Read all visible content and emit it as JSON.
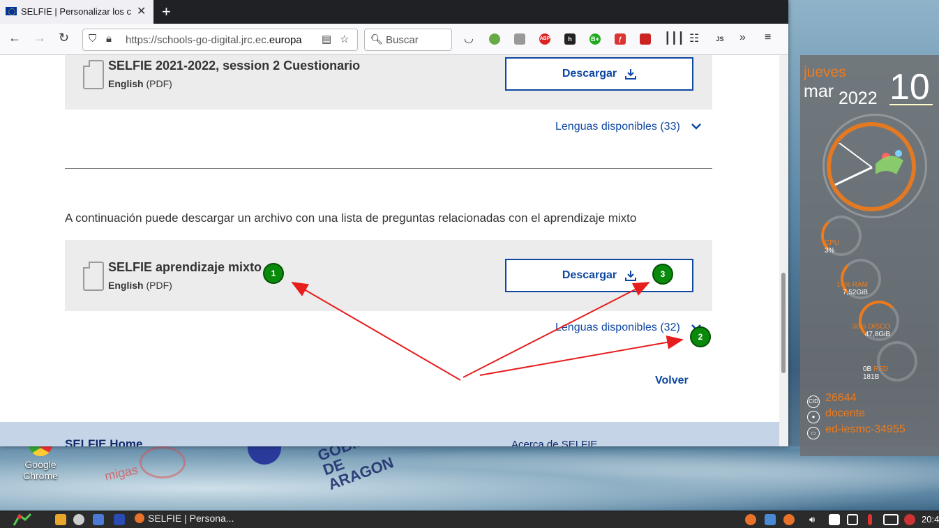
{
  "browser": {
    "tab_title": "SELFIE | Personalizar los c",
    "tab_close": "✕",
    "new_tab": "+",
    "url_prefix": "https://schools-go-digital.jrc.ec.",
    "url_domain": "europa",
    "search_placeholder": "Buscar",
    "ext_abp": "ABP",
    "ext_js": "JS",
    "ext_bplus": "B+"
  },
  "page": {
    "card1": {
      "title": "SELFIE 2021-2022, session 2 Cuestionario",
      "lang": "English",
      "format": "(PDF)",
      "download_label": "Descargar",
      "languages_link": "Lenguas disponibles (33)"
    },
    "intro_text": "A continuación puede descargar un archivo con una lista de preguntas relacionadas con el aprendizaje mixto",
    "card2": {
      "title": "SELFIE aprendizaje mixto",
      "lang": "English",
      "format": "(PDF)",
      "download_label": "Descargar",
      "languages_link": "Lenguas disponibles (32)"
    },
    "back_link": "Volver",
    "footer": {
      "home": "SELFIE Home",
      "about": "Acerca de SELFIE"
    }
  },
  "annotations": {
    "badge1": "1",
    "badge2": "2",
    "badge3": "3",
    "arrow_color": "#e61e1e",
    "badge_color": "#0a8a0a"
  },
  "desktop": {
    "chrome_icon_label": "Google Chrome",
    "migas": "migas",
    "aragon": "GOBIERNO DE ARAGON"
  },
  "conky": {
    "weekday": "jueves",
    "month": "mar",
    "year": "2022",
    "day": "10",
    "cpu_label": "CPU",
    "cpu_value": "3%",
    "ram_label": "14% RAM",
    "ram_value": "7,52GiB",
    "disk_label": "30% DISCO",
    "disk_value": "47,8GiB",
    "net_down": "0B",
    "net_label": "RED",
    "net_up": "181B",
    "cid_icon_text": "CID",
    "cid": "26644",
    "user": "docente",
    "host": "ed-iesmc-34955",
    "accent": "#f07a1a"
  },
  "taskbar": {
    "task_title": "SELFIE | Persona...",
    "clock": "20:4"
  }
}
